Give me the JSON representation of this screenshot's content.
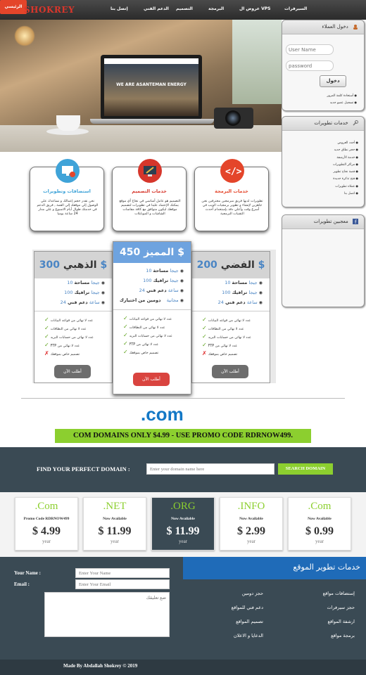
{
  "nav": {
    "logo": "SHOKREY",
    "items": [
      "الرئيسي",
      "السيرفرات",
      "عروض ال VPS",
      "البرمجة",
      "التصميم",
      "الدعم الفني",
      "إتصل بنا"
    ]
  },
  "hero": {
    "screen_text": "WE ARE ASANTEMAN ENERGY"
  },
  "login": {
    "title": "دخول العملاء",
    "username_placeholder": "User Name",
    "password_placeholder": "password",
    "button": "دخول",
    "links": [
      "أستعادة كلمة المرور",
      "تسجيل عضو جديد"
    ]
  },
  "services_box": {
    "title": "خدمات تطويرات",
    "items": [
      "أجدد العروض",
      "حجز نطاق جديد",
      "خدمة الأرشفة",
      "مراكز التطويرات",
      "قصة نجاح تطوير",
      "فتح تذكرة جديدة",
      "عملاء تطويرات",
      "اتصل بنا"
    ]
  },
  "fans": {
    "title": "معجبين تطويرات"
  },
  "features": [
    {
      "title": "استضافات وتطويرات",
      "text": "نحن نقدر حجم إعمالك و نساعدك علي الوصول إلي موقعك إلي القمة , فريق الدعم في خدمتك طوال أيام الاسبوع و علي مدار 24 ساعة يوميا",
      "color": "#3fa3d8"
    },
    {
      "title": "خدمات التصميم",
      "text": "التصميم هو عامل أساسي في نجاح أي موقع يمكنك الإعتماد علينا في تطويرات لتصميم موقعك ليكون متوافق مع كافة مقاسات الشاشات و الموبايلات",
      "color": "#d6362b"
    },
    {
      "title": "خدمات البرمجة",
      "text": "تطويرات لديها فريق مبرمجين محترفين نحن جاهزين لإنشاء و تطوير برمجيات الويب في أسرع وقت وأعلي دقة بإستخدام أحدث التقنيات البرمجية",
      "color": "#e4452a"
    }
  ],
  "plans": [
    {
      "name": "الذهبي",
      "price": "300 $",
      "rows": [
        [
          "مساحة",
          "10 جيجا"
        ],
        [
          "ترافيك",
          "100 جيجا"
        ],
        [
          "دعم فني",
          "24 ساعة"
        ]
      ],
      "button": "أطلب الآن",
      "header_color": "#d4d4d4",
      "button_color": "#6d6d6d"
    },
    {
      "name": "المميز",
      "price": "450 $",
      "rows": [
        [
          "مساحة",
          "10 جيجا"
        ],
        [
          "ترافيك",
          "100 جيجا"
        ],
        [
          "دعم فني",
          "24 ساعة"
        ],
        [
          "دومين من اختيارك",
          "مجانية"
        ]
      ],
      "button": "أطلب الآن",
      "header_color": "#6ea3df",
      "button_color": "#d9443f"
    },
    {
      "name": "الفضي",
      "price": "200 $",
      "rows": [
        [
          "مساحة",
          "10 جيجا"
        ],
        [
          "ترافيك",
          "100 جيجا"
        ],
        [
          "دعم فني",
          "24 ساعة"
        ]
      ],
      "button": "أطلب الآن",
      "header_color": "#d4d4d4",
      "button_color": "#6d6d6d"
    }
  ],
  "plan_checks": [
    {
      "text": "عدد لا نهائي من قواعد البيانات",
      "ok": true
    },
    {
      "text": "عدد لا نهائي من النطاقات",
      "ok": true
    },
    {
      "text": "عدد لا نهائي من حسابات البريد",
      "ok": true
    },
    {
      "text": "FTP عدد لا نهائي من",
      "ok": true
    },
    {
      "text": "تصميم خاص بموقعك",
      "ok": false
    }
  ],
  "plan_checks_premium": [
    {
      "text": "عدد لا نهائي من قواعد البيانات",
      "ok": true
    },
    {
      "text": "عدد لا نهائي من النطاقات",
      "ok": true
    },
    {
      "text": "عدد لا نهائي من حسابات البريد",
      "ok": true
    },
    {
      "text": "FTP عدد لا نهائي من",
      "ok": true
    },
    {
      "text": "تصميم خاص بموقعك",
      "ok": true
    }
  ],
  "domain": {
    "logo": ".com",
    "promo": "COM DOMAINS ONLY $4.99 - USE PROMO CODE RDRNOW499.",
    "search_label": "FIND YOUR PERFECT DOMAIN :",
    "search_placeholder": "Enter your domain name here",
    "search_button": "SEARCH DOMAIN",
    "tlds": [
      {
        "name": ".Com",
        "sub": "Promo Code RDRNOW499",
        "price": "$ 4.99",
        "unit": "year"
      },
      {
        "name": ".NET",
        "sub": "Now Available",
        "price": "$ 11.99",
        "unit": "year"
      },
      {
        "name": ".ORG",
        "sub": "Now Available",
        "price": "$ 11.99",
        "unit": "year"
      },
      {
        "name": ".INFO",
        "sub": "Now Available",
        "price": "$ 2.99",
        "unit": "year"
      },
      {
        "name": ".Com",
        "sub": "Now Available",
        "price": "$ 0.99",
        "unit": "year"
      }
    ]
  },
  "contact": {
    "name_label": "Your Name :",
    "email_label": "Email :",
    "name_placeholder": "Enter Your Name",
    "email_placeholder": "Enter Your Email",
    "comment_placeholder": "ضع تعليقك"
  },
  "footer_services": {
    "title": "خدمات تطوير الموقع",
    "items": [
      "إستضافات مواقع",
      "حجز دومين",
      "حجز سيرفرات",
      "دعم فني للمواقع",
      "ارشفة المواقع",
      "تصميم المواقع",
      "برمجة مواقع",
      "الدعايا و الاعلان"
    ]
  },
  "copyright": "Made By Abdallah Shokrey © 2019"
}
